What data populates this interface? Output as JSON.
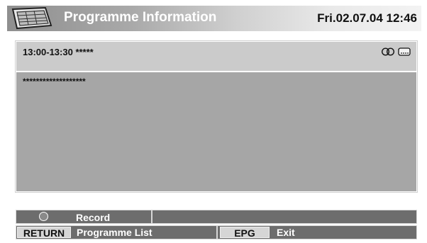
{
  "header": {
    "title": "Programme Information",
    "datetime": "Fri.02.07.04 12:46",
    "icon": "guide-book-icon"
  },
  "programme": {
    "time_slot": "13:00-13:30 *****",
    "description": "*******************",
    "icons": [
      "stereo-icon",
      "subtitle-icon"
    ]
  },
  "footer": {
    "record_label": "Record",
    "return_key": "RETURN",
    "return_label": "Programme List",
    "epg_key": "EPG",
    "epg_label": "Exit"
  },
  "colors": {
    "panel": "#a6a6a6",
    "panel_top": "#cbcbcb",
    "footer_bg": "#6d6d6d",
    "key_bg": "#d6d6d6"
  }
}
